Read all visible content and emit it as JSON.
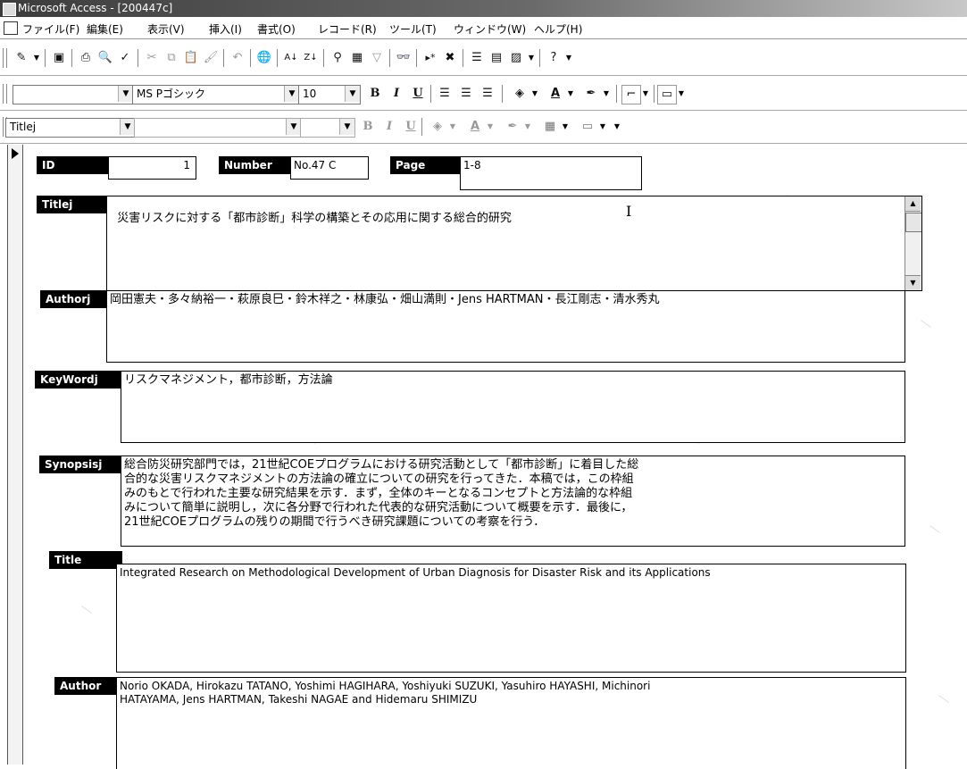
{
  "window": {
    "title": "Microsoft Access - [200447c]"
  },
  "menu": [
    "ファイル(F)",
    "編集(E)",
    "表示(V)",
    "挿入(I)",
    "書式(O)",
    "レコード(R)",
    "ツール(T)",
    "ウィンドウ(W)",
    "ヘルプ(H)"
  ],
  "formatting": {
    "object_combo": "",
    "font": "MS Pゴシック",
    "size": "10",
    "bold": "B",
    "italic": "I",
    "underline": "U"
  },
  "form_toolbar": {
    "object_combo": "Titlej",
    "font": "",
    "size": "",
    "bold": "B",
    "italic": "I",
    "underline": "U"
  },
  "fields": {
    "id": {
      "label": "ID",
      "value": "1"
    },
    "number": {
      "label": "Number",
      "value": "No.47 C"
    },
    "page": {
      "label": "Page",
      "value": "1-8"
    },
    "titlej": {
      "label": "Titlej",
      "value": "災害リスクに対する「都市診断」科学の構築とその応用に関する総合的研究"
    },
    "authorj": {
      "label": "Authorj",
      "value": "岡田憲夫・多々納裕一・萩原良巳・鈴木祥之・林康弘・畑山満則・Jens HARTMAN・長江剛志・清水秀丸"
    },
    "keywordj": {
      "label": "KeyWordj",
      "value": "リスクマネジメント，都市診断，方法論"
    },
    "synopsisj": {
      "label": "Synopsisj",
      "value": "総合防災研究部門では，21世紀COEプログラムにおける研究活動として「都市診断」に着目した総\n合的な災害リスクマネジメントの方法論の確立についての研究を行ってきた．本稿では，この枠組\nみのもとで行われた主要な研究結果を示す．まず，全体のキーとなるコンセプトと方法論的な枠組\nみについて簡単に説明し，次に各分野で行われた代表的な研究活動について概要を示す．最後に，\n21世紀COEプログラムの残りの期間で行うべき研究課題についての考察を行う．"
    },
    "title": {
      "label": "Title",
      "value": "Integrated Research on Methodological Development of Urban Diagnosis for Disaster Risk and its Applications"
    },
    "author": {
      "label": "Author",
      "value": "Norio OKADA, Hirokazu TATANO, Yoshimi HAGIHARA, Yoshiyuki SUZUKI, Yasuhiro HAYASHI, Michinori\nHATAYAMA, Jens HARTMAN, Takeshi NAGAE and Hidemaru SHIMIZU"
    }
  }
}
